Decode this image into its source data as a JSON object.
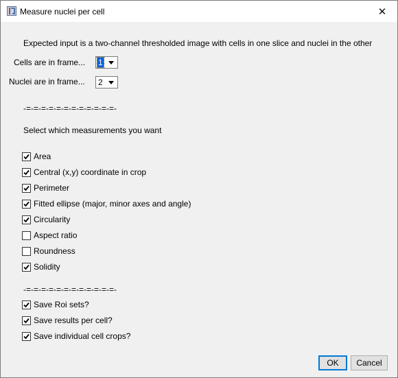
{
  "window": {
    "title": "Measure nuclei per cell",
    "app_icon": "imagej-icon",
    "close_glyph": "✕"
  },
  "intro_text": "Expected input is a two-channel thresholded image with cells in one slice and nuclei in the other",
  "cells_frame": {
    "label": "Cells are in frame...",
    "value": "1"
  },
  "nuclei_frame": {
    "label": "Nuclei are in frame...",
    "value": "2"
  },
  "separator_1": "-=-=-=-=-=-=-=-=-=-=-=-=-",
  "section_heading": "Select which measurements you want",
  "measurements": [
    {
      "label": "Area",
      "checked": true
    },
    {
      "label": "Central (x,y) coordinate in crop",
      "checked": true
    },
    {
      "label": "Perimeter",
      "checked": true
    },
    {
      "label": "Fitted ellipse (major, minor axes and angle)",
      "checked": true
    },
    {
      "label": "Circularity",
      "checked": true
    },
    {
      "label": "Aspect ratio",
      "checked": false
    },
    {
      "label": "Roundness",
      "checked": false
    },
    {
      "label": "Solidity",
      "checked": true
    }
  ],
  "separator_2": "-=-=-=-=-=-=-=-=-=-=-=-=-",
  "save_options": [
    {
      "label": "Save Roi sets?",
      "checked": true
    },
    {
      "label": "Save results per cell?",
      "checked": true
    },
    {
      "label": "Save individual cell crops?",
      "checked": true
    }
  ],
  "buttons": {
    "ok": "OK",
    "cancel": "Cancel"
  }
}
